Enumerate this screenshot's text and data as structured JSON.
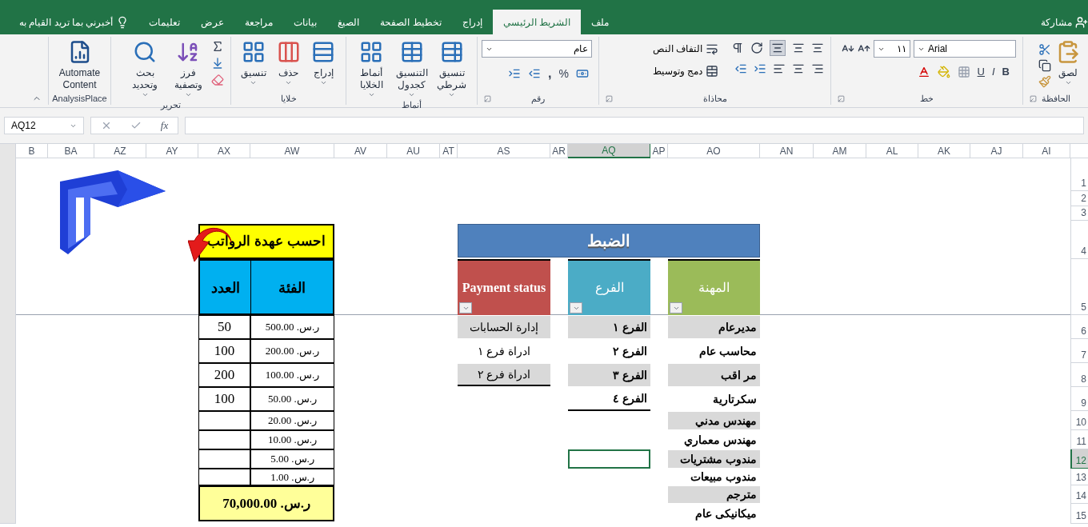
{
  "ribbon_tabs": [
    {
      "label": "ملف",
      "selected": false
    },
    {
      "label": "الشريط الرئيسي",
      "selected": true
    },
    {
      "label": "إدراج",
      "selected": false
    },
    {
      "label": "تخطيط الصفحة",
      "selected": false
    },
    {
      "label": "الصيغ",
      "selected": false
    },
    {
      "label": "بيانات",
      "selected": false
    },
    {
      "label": "مراجعة",
      "selected": false
    },
    {
      "label": "عرض",
      "selected": false
    },
    {
      "label": "تعليمات",
      "selected": false
    }
  ],
  "tell_me": "أخبرني بما تريد القيام به",
  "share": "مشاركة",
  "clipboard": {
    "label": "الحافظة",
    "paste": "لصق"
  },
  "font": {
    "label": "خط",
    "name": "Arial",
    "size": "١١",
    "bold": "B",
    "italic": "I",
    "underline": "U"
  },
  "alignment": {
    "label": "محاذاة",
    "wrap": "التفاف النص",
    "merge": "دمج وتوسيط"
  },
  "number": {
    "label": "رقم",
    "format": "عام",
    "percent": "%",
    "comma": ","
  },
  "styles": {
    "label": "أنماط",
    "buttons": [
      "تنسيق شرطي",
      "التنسيق كجدول",
      "أنماط الخلايا"
    ]
  },
  "cells": {
    "label": "خلايا",
    "buttons": [
      "إدراج",
      "حذف",
      "تنسيق"
    ]
  },
  "editing": {
    "label": "تحرير",
    "buttons": [
      "فرز وتصفية",
      "بحث وتحديد"
    ]
  },
  "addin": {
    "label": "AnalysisPlace",
    "button": "Automate Content"
  },
  "formula_bar": {
    "name_box": "AQ12",
    "fx": "fx"
  },
  "columns": [
    {
      "label": "AI",
      "selected": false
    },
    {
      "label": "AJ",
      "selected": false
    },
    {
      "label": "AK",
      "selected": false
    },
    {
      "label": "AL",
      "selected": false
    },
    {
      "label": "AM",
      "selected": false
    },
    {
      "label": "AN",
      "selected": false
    },
    {
      "label": "AO",
      "selected": false
    },
    {
      "label": "AP",
      "selected": false
    },
    {
      "label": "AQ",
      "selected": true
    },
    {
      "label": "AR",
      "selected": false
    },
    {
      "label": "AS",
      "selected": false
    },
    {
      "label": "AT",
      "selected": false
    },
    {
      "label": "AU",
      "selected": false
    },
    {
      "label": "AV",
      "selected": false
    },
    {
      "label": "AW",
      "selected": false
    },
    {
      "label": "AX",
      "selected": false
    },
    {
      "label": "AY",
      "selected": false
    },
    {
      "label": "AZ",
      "selected": false
    },
    {
      "label": "BA",
      "selected": false
    },
    {
      "label": "B",
      "selected": false
    }
  ],
  "rows": [
    {
      "label": "1",
      "selected": false
    },
    {
      "label": "2",
      "selected": false
    },
    {
      "label": "3",
      "selected": false
    },
    {
      "label": "4",
      "selected": false
    },
    {
      "label": "5",
      "selected": false
    },
    {
      "label": "6",
      "selected": false
    },
    {
      "label": "7",
      "selected": false
    },
    {
      "label": "8",
      "selected": false
    },
    {
      "label": "9",
      "selected": false
    },
    {
      "label": "10",
      "selected": false
    },
    {
      "label": "11",
      "selected": false
    },
    {
      "label": "12",
      "selected": true
    },
    {
      "label": "13",
      "selected": false
    },
    {
      "label": "14",
      "selected": false
    },
    {
      "label": "15",
      "selected": false
    }
  ],
  "payroll": {
    "title": "احسب عهدة الرواتب",
    "headers": [
      "الفئة",
      "العدد"
    ],
    "rows": [
      {
        "denomination": "ر.س. 500.00",
        "count": "50"
      },
      {
        "denomination": "ر.س. 200.00",
        "count": "100"
      },
      {
        "denomination": "ر.س. 100.00",
        "count": "200"
      },
      {
        "denomination": "ر.س. 50.00",
        "count": "100"
      },
      {
        "denomination": "ر.س. 20.00"
      },
      {
        "denomination": "ر.س. 10.00"
      },
      {
        "denomination": "ر.س. 5.00"
      },
      {
        "denomination": "ر.س. 1.00"
      }
    ],
    "total": "ر.س. 70,000.00"
  },
  "control": {
    "title": "الضبط",
    "tables": [
      {
        "header": "المهنة",
        "color": "#9bbb59",
        "items": [
          "مديرعام",
          "محاسب عام",
          "مر اقب",
          "سكرتارية",
          "مهندس مدني",
          "مهندس معماري",
          "مندوب مشتريات",
          "مندوب مبيعات",
          "مترجم",
          "ميكانيكى عام"
        ]
      },
      {
        "header": "الفرع",
        "color": "#4bacc6",
        "items": [
          "الفرع ١",
          "الفرع ٢",
          "الفرع ٣",
          "الفرع ٤"
        ]
      },
      {
        "header": "Payment status",
        "color": "#c0504d",
        "items": [
          "إدارة الحسابات",
          "ادراة فرع ١",
          "ادراة فرع ٢"
        ]
      }
    ]
  }
}
